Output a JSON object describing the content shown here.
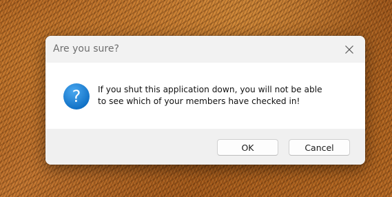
{
  "dialog": {
    "title": "Are you sure?",
    "close_icon": "close-icon",
    "icon": "question-icon",
    "message_line1": "If you shut this application down, you will not be able",
    "message_line2": "to see which of your members have checked in!",
    "ok_label": "OK",
    "cancel_label": "Cancel"
  },
  "colors": {
    "icon_blue": "#1a7fd6",
    "titlebar": "#f2f2f2",
    "footer": "#f0f0f0"
  }
}
